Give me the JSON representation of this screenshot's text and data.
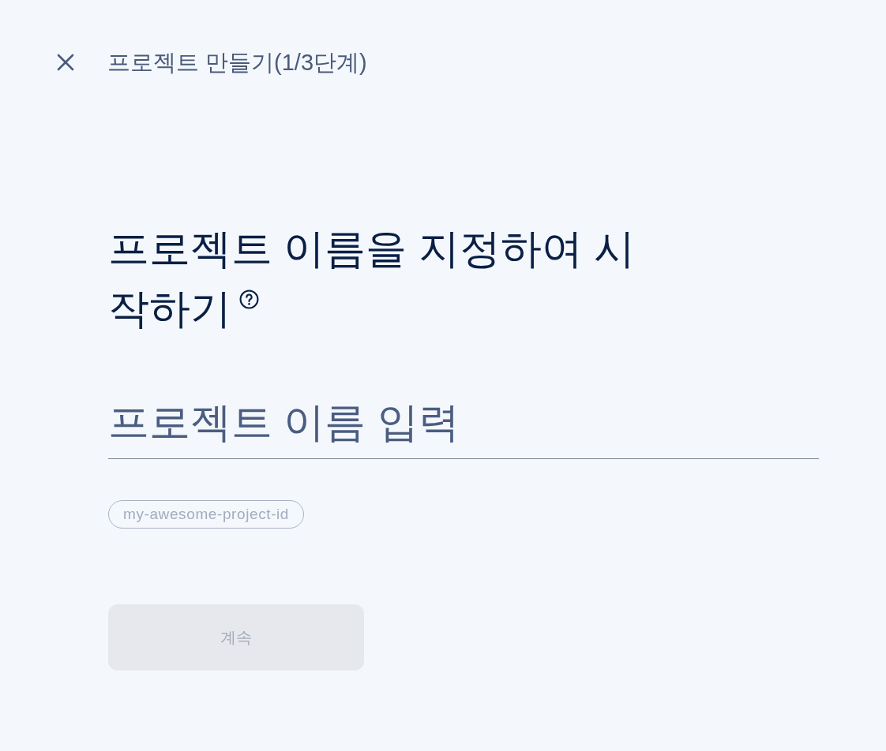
{
  "header": {
    "title": "프로젝트 만들기(1/3단계)"
  },
  "heading": {
    "lines": [
      "프로젝트 이름을 지정하여 시",
      "작하기"
    ]
  },
  "name_field": {
    "placeholder": "프로젝트 이름 입력"
  },
  "project_id_chip": {
    "text": "my-awesome-project-id"
  },
  "continue_button": {
    "label": "계속",
    "disabled": true
  }
}
